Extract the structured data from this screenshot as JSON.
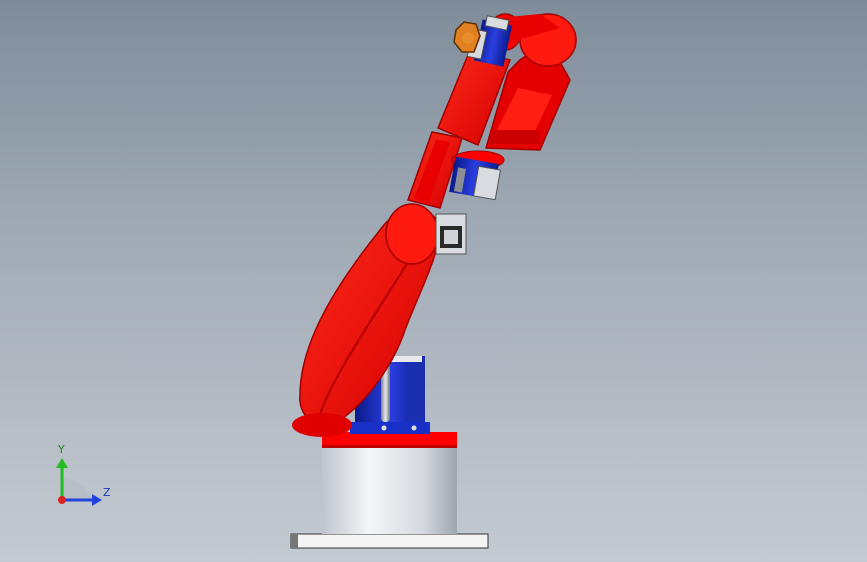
{
  "viewport": {
    "background_top": "#7f8c9a",
    "background_bottom": "#c4cad1"
  },
  "model": {
    "arm_color": "#ff0000",
    "motor_color": "#1428c8",
    "base_color": "#dde2e8",
    "plate_color": "#f2f2f2"
  },
  "triad": {
    "y_label": "Y",
    "z_label": "Z",
    "y_color": "#22bb22",
    "z_color": "#2244dd",
    "x_color": "#dd2222"
  }
}
